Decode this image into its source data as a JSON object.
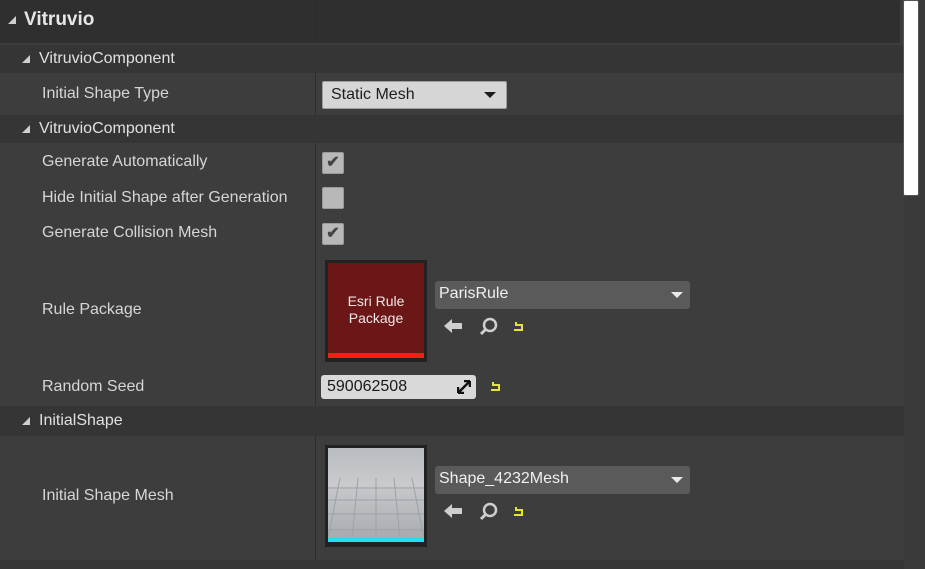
{
  "category": {
    "title": "Vitruvio"
  },
  "sections": [
    {
      "title": "VitruvioComponent"
    },
    {
      "title": "VitruvioComponent"
    },
    {
      "title": "InitialShape"
    }
  ],
  "rows": {
    "initial_shape_type": {
      "label": "Initial Shape Type",
      "value": "Static Mesh"
    },
    "generate_automatically": {
      "label": "Generate Automatically",
      "checked": true
    },
    "hide_initial_shape": {
      "label": "Hide Initial Shape after Generation",
      "checked": false
    },
    "generate_collision": {
      "label": "Generate Collision Mesh",
      "checked": true
    },
    "rule_package": {
      "label": "Rule Package",
      "thumbnail_line1": "Esri Rule",
      "thumbnail_line2": "Package",
      "asset": "ParisRule",
      "accent_color": "#ff1a1a"
    },
    "random_seed": {
      "label": "Random Seed",
      "value": "590062508"
    },
    "initial_shape_mesh": {
      "label": "Initial Shape Mesh",
      "asset": "Shape_4232Mesh",
      "accent_color": "#22e0f0"
    }
  },
  "icons": {
    "use_selected": "arrow-left-icon",
    "browse": "search-icon",
    "reset": "reset-to-default-icon"
  },
  "colors": {
    "background": "#3d3d3d",
    "header": "#2f2f2f",
    "reset_yellow": "#e8e23c"
  }
}
